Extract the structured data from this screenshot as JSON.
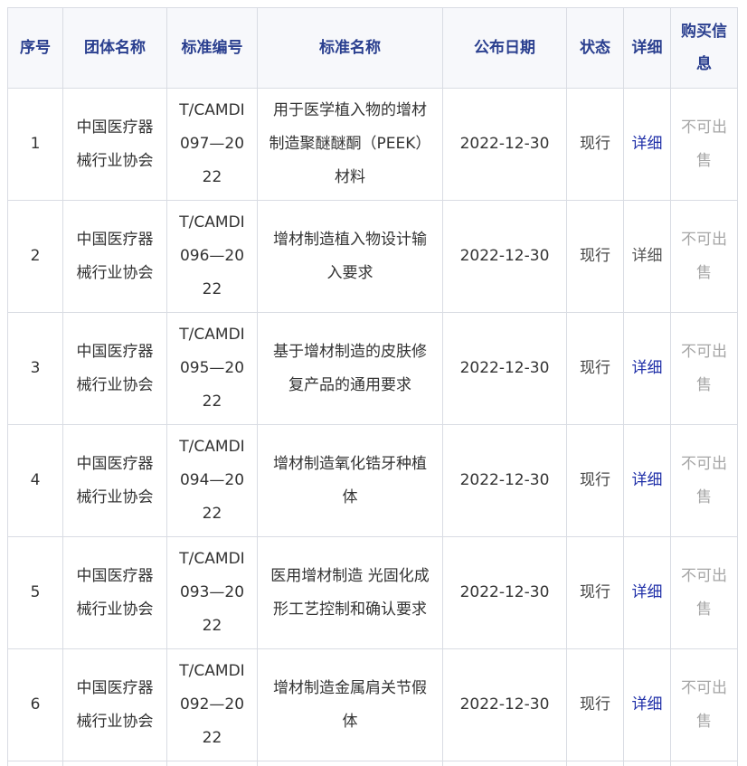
{
  "headers": [
    "序号",
    "团体名称",
    "标准编号",
    "标准名称",
    "公布日期",
    "状态",
    "详细",
    "购买信息"
  ],
  "rows": [
    {
      "no": "1",
      "org": "中国医疗器械行业协会",
      "code": "T/CAMDI 097—2022",
      "name": "用于医学植入物的增材制造聚醚醚酮（PEEK）材料",
      "date": "2022-12-30",
      "status": "现行",
      "detail": "详细",
      "buy": "不可出售"
    },
    {
      "no": "2",
      "org": "中国医疗器械行业协会",
      "code": "T/CAMDI 096—2022",
      "name": "增材制造植入物设计输入要求",
      "date": "2022-12-30",
      "status": "现行",
      "detail": "详细",
      "buy": "不可出售"
    },
    {
      "no": "3",
      "org": "中国医疗器械行业协会",
      "code": "T/CAMDI 095—2022",
      "name": "基于增材制造的皮肤修复产品的通用要求",
      "date": "2022-12-30",
      "status": "现行",
      "detail": "详细",
      "buy": "不可出售"
    },
    {
      "no": "4",
      "org": "中国医疗器械行业协会",
      "code": "T/CAMDI 094—2022",
      "name": "增材制造氧化锆牙种植体",
      "date": "2022-12-30",
      "status": "现行",
      "detail": "详细",
      "buy": "不可出售"
    },
    {
      "no": "5",
      "org": "中国医疗器械行业协会",
      "code": "T/CAMDI 093—2022",
      "name": "医用增材制造 光固化成形工艺控制和确认要求",
      "date": "2022-12-30",
      "status": "现行",
      "detail": "详细",
      "buy": "不可出售"
    },
    {
      "no": "6",
      "org": "中国医疗器械行业协会",
      "code": "T/CAMDI 092—2022",
      "name": "增材制造金属肩关节假体",
      "date": "2022-12-30",
      "status": "现行",
      "detail": "详细",
      "buy": "不可出售"
    }
  ]
}
